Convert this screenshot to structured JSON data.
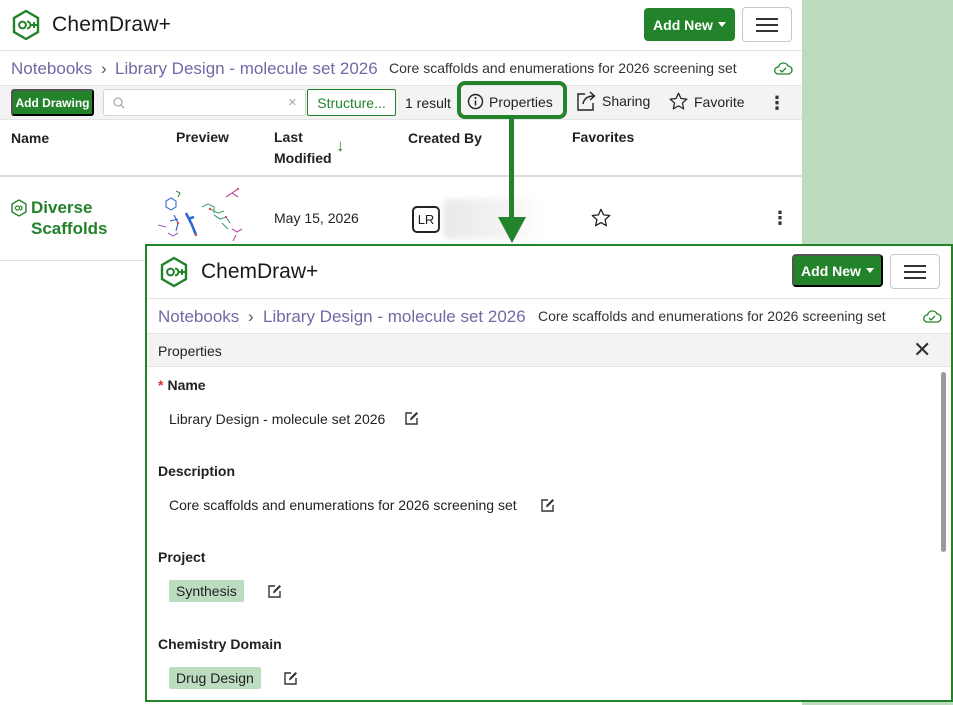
{
  "app": {
    "name": "ChemDraw+"
  },
  "header": {
    "add_new_label": "Add New"
  },
  "breadcrumb": {
    "root": "Notebooks",
    "separator": "›",
    "current": "Library Design - molecule set 2026",
    "description": "Core scaffolds and enumerations for 2026 screening set"
  },
  "toolbar": {
    "add_drawing_label": "Add Drawing",
    "search_placeholder": "",
    "clear_glyph": "×",
    "structure_label": "Structure...",
    "result_count": "1 result",
    "properties_label": "Properties",
    "sharing_label": "Sharing",
    "favorite_label": "Favorite",
    "more_glyph": "⋮"
  },
  "table": {
    "headers": {
      "name": "Name",
      "preview": "Preview",
      "last_modified_1": "Last",
      "last_modified_2": "Modified",
      "created_by": "Created By",
      "favorites": "Favorites"
    },
    "sort_glyph": "↓",
    "rows": [
      {
        "name_line1": "Diverse",
        "name_line2": "Scaffolds",
        "last_modified": "May 15, 2026",
        "created_by_initials": "LR",
        "more_glyph": "⋮"
      }
    ]
  },
  "properties_panel": {
    "title": "Properties",
    "close_glyph": "✕",
    "required_mark": "*",
    "fields": {
      "name_label": "Name",
      "name_value": "Library Design - molecule set 2026",
      "description_label": "Description",
      "description_value": "Core scaffolds and enumerations for 2026 screening set",
      "project_label": "Project",
      "project_value": "Synthesis",
      "domain_label": "Chemistry Domain",
      "domain_value": "Drug Design"
    }
  },
  "colors": {
    "brand_green": "#23832b",
    "link_purple": "#6f6aa6",
    "tag_green": "#bcdcbf"
  },
  "icons": [
    "chemdraw-logo-icon",
    "search-icon",
    "info-icon",
    "share-icon",
    "star-icon",
    "kebab-icon",
    "cloud-check-icon",
    "edit-icon",
    "close-icon"
  ]
}
